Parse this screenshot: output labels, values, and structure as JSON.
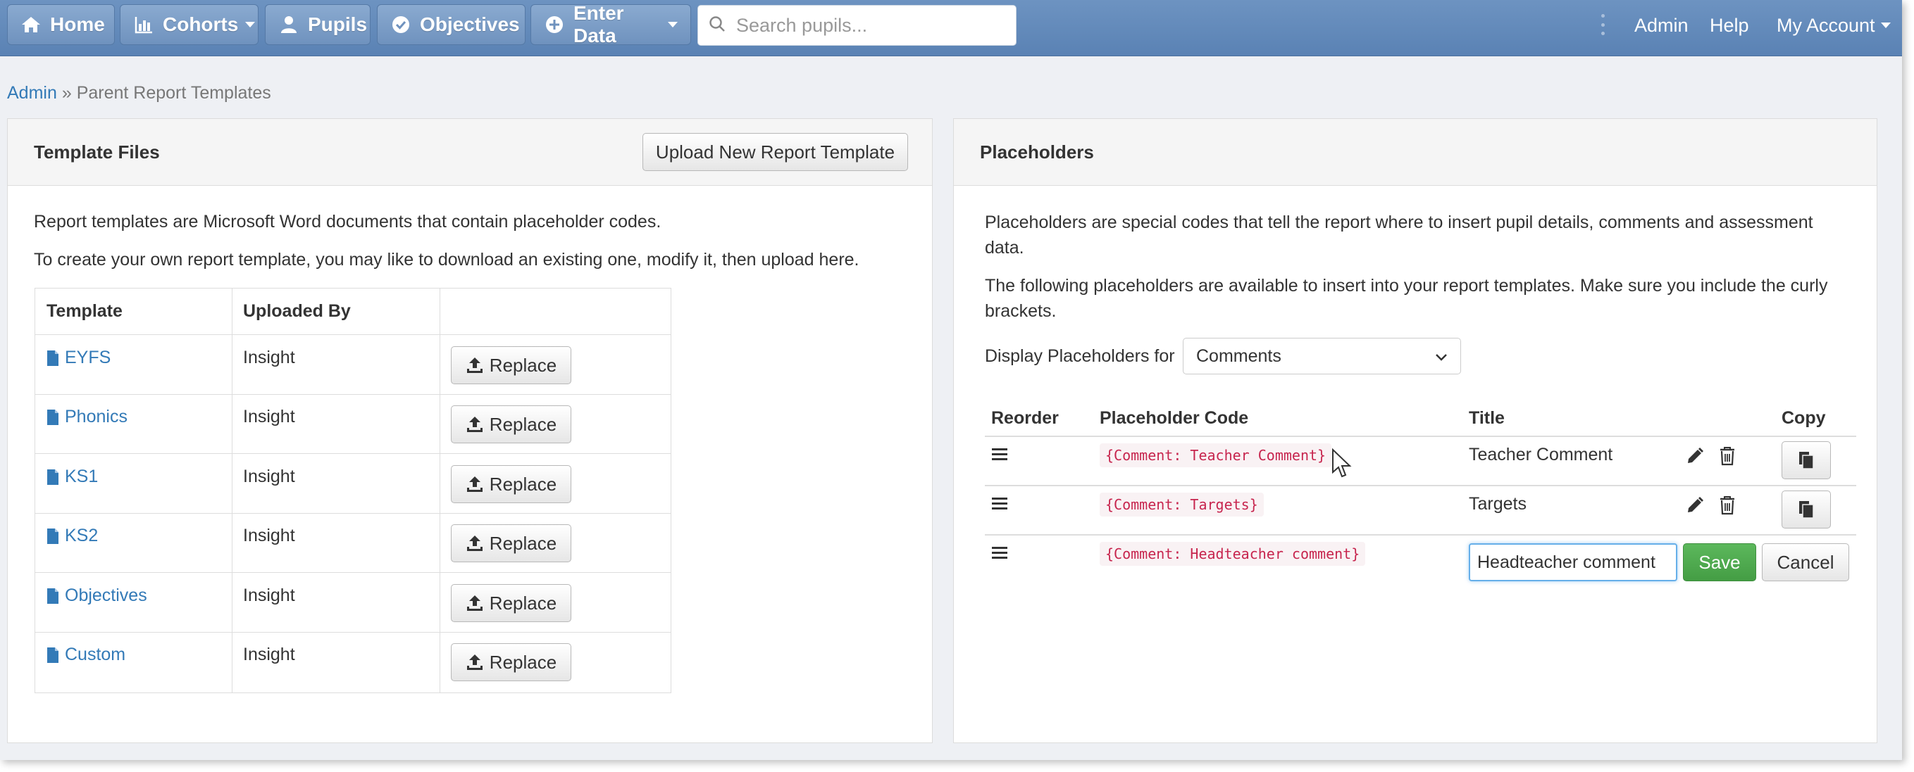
{
  "nav": {
    "home": "Home",
    "cohorts": "Cohorts",
    "pupils": "Pupils",
    "objectives": "Objectives",
    "enter_data": "Enter Data",
    "search_placeholder": "Search pupils...",
    "admin": "Admin",
    "help": "Help",
    "my_account": "My Account"
  },
  "breadcrumb": {
    "root": "Admin",
    "separator": "»",
    "current": "Parent Report Templates"
  },
  "template_files": {
    "title": "Template Files",
    "upload_button": "Upload New Report Template",
    "intro_1": "Report templates are Microsoft Word documents that contain placeholder codes.",
    "intro_2": "To create your own report template, you may like to download an existing one, modify it, then upload here.",
    "columns": [
      "Template",
      "Uploaded By",
      ""
    ],
    "rows": [
      {
        "name": "EYFS",
        "uploaded_by": "Insight",
        "action": "Replace"
      },
      {
        "name": "Phonics",
        "uploaded_by": "Insight",
        "action": "Replace"
      },
      {
        "name": "KS1",
        "uploaded_by": "Insight",
        "action": "Replace"
      },
      {
        "name": "KS2",
        "uploaded_by": "Insight",
        "action": "Replace"
      },
      {
        "name": "Objectives",
        "uploaded_by": "Insight",
        "action": "Replace"
      },
      {
        "name": "Custom",
        "uploaded_by": "Insight",
        "action": "Replace"
      }
    ]
  },
  "placeholders": {
    "title": "Placeholders",
    "intro_1_line1": "Placeholders are special codes that tell the report where to insert pupil details, comments and assessment",
    "intro_1_line2": "data.",
    "intro_2_line1": "The following placeholders are available to insert into your report templates. Make sure you include the curly",
    "intro_2_line2": "brackets.",
    "display_label": "Display Placeholders for",
    "display_value": "Comments",
    "columns": [
      "Reorder",
      "Placeholder Code",
      "Title",
      "",
      "Copy"
    ],
    "rows": [
      {
        "code": "{Comment: Teacher Comment}",
        "title": "Teacher Comment"
      },
      {
        "code": "{Comment: Targets}",
        "title": "Targets"
      },
      {
        "code": "{Comment: Headteacher comment}",
        "edit_value": "Headteacher comment",
        "save": "Save",
        "cancel": "Cancel"
      }
    ]
  },
  "colors": {
    "navbar": "#5a82b4",
    "link": "#337ab7",
    "code_text": "#c7254e",
    "save_green": "#5cb85c"
  }
}
